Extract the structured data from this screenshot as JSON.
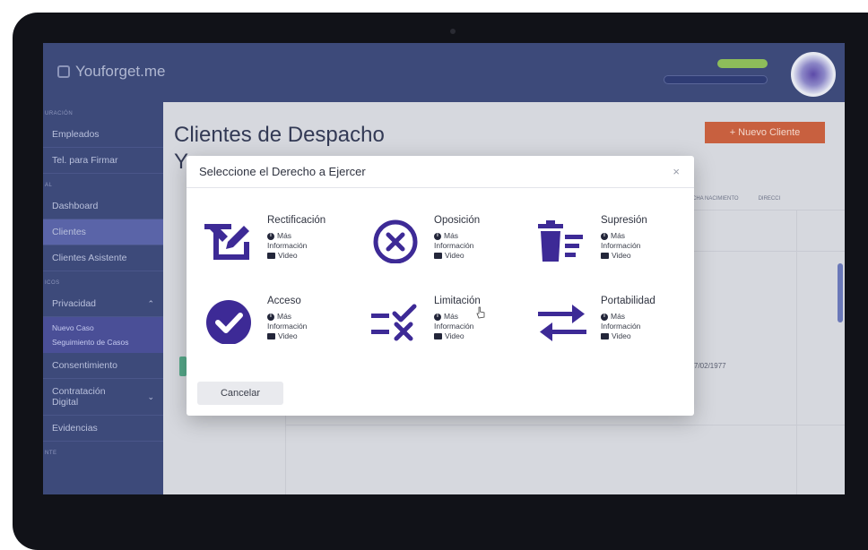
{
  "app": {
    "brand": "Youforget.me"
  },
  "sidebar": {
    "sections": [
      "URACIÓN",
      "AL",
      "ICOS",
      "NTE"
    ],
    "items": [
      {
        "label": "Empleados"
      },
      {
        "label": "Tel. para Firmar"
      },
      {
        "label": "Dashboard"
      },
      {
        "label": "Clientes"
      },
      {
        "label": "Clientes Asistente"
      },
      {
        "label": "Privacidad"
      },
      {
        "label": "Consentimiento"
      },
      {
        "label": "Contratación Digital"
      },
      {
        "label": "Evidencias"
      }
    ],
    "privacidad_sub": [
      "Nuevo Caso",
      "Seguimiento de Casos"
    ]
  },
  "main": {
    "title": "Clientes de Despacho",
    "title_line2": "Y",
    "new_client_label": "+ Nuevo Cliente",
    "table_headers": [
      "CHA NACIMIENTO",
      "DIRECCI"
    ],
    "row_date": "7/02/1977"
  },
  "modal": {
    "title": "Seleccione el Derecho a Ejercer",
    "close": "×",
    "more_info_1": "Más",
    "more_info_2": "Información",
    "video": "Video",
    "options": [
      {
        "title": "Rectificación"
      },
      {
        "title": "Oposición"
      },
      {
        "title": "Supresión"
      },
      {
        "title": "Acceso"
      },
      {
        "title": "Limitación"
      },
      {
        "title": "Portabilidad"
      }
    ],
    "cancel_label": "Cancelar"
  },
  "colors": {
    "icon": "#3d2a96",
    "sidebar": "#3d4a7a",
    "accent_button": "#c8603f"
  }
}
